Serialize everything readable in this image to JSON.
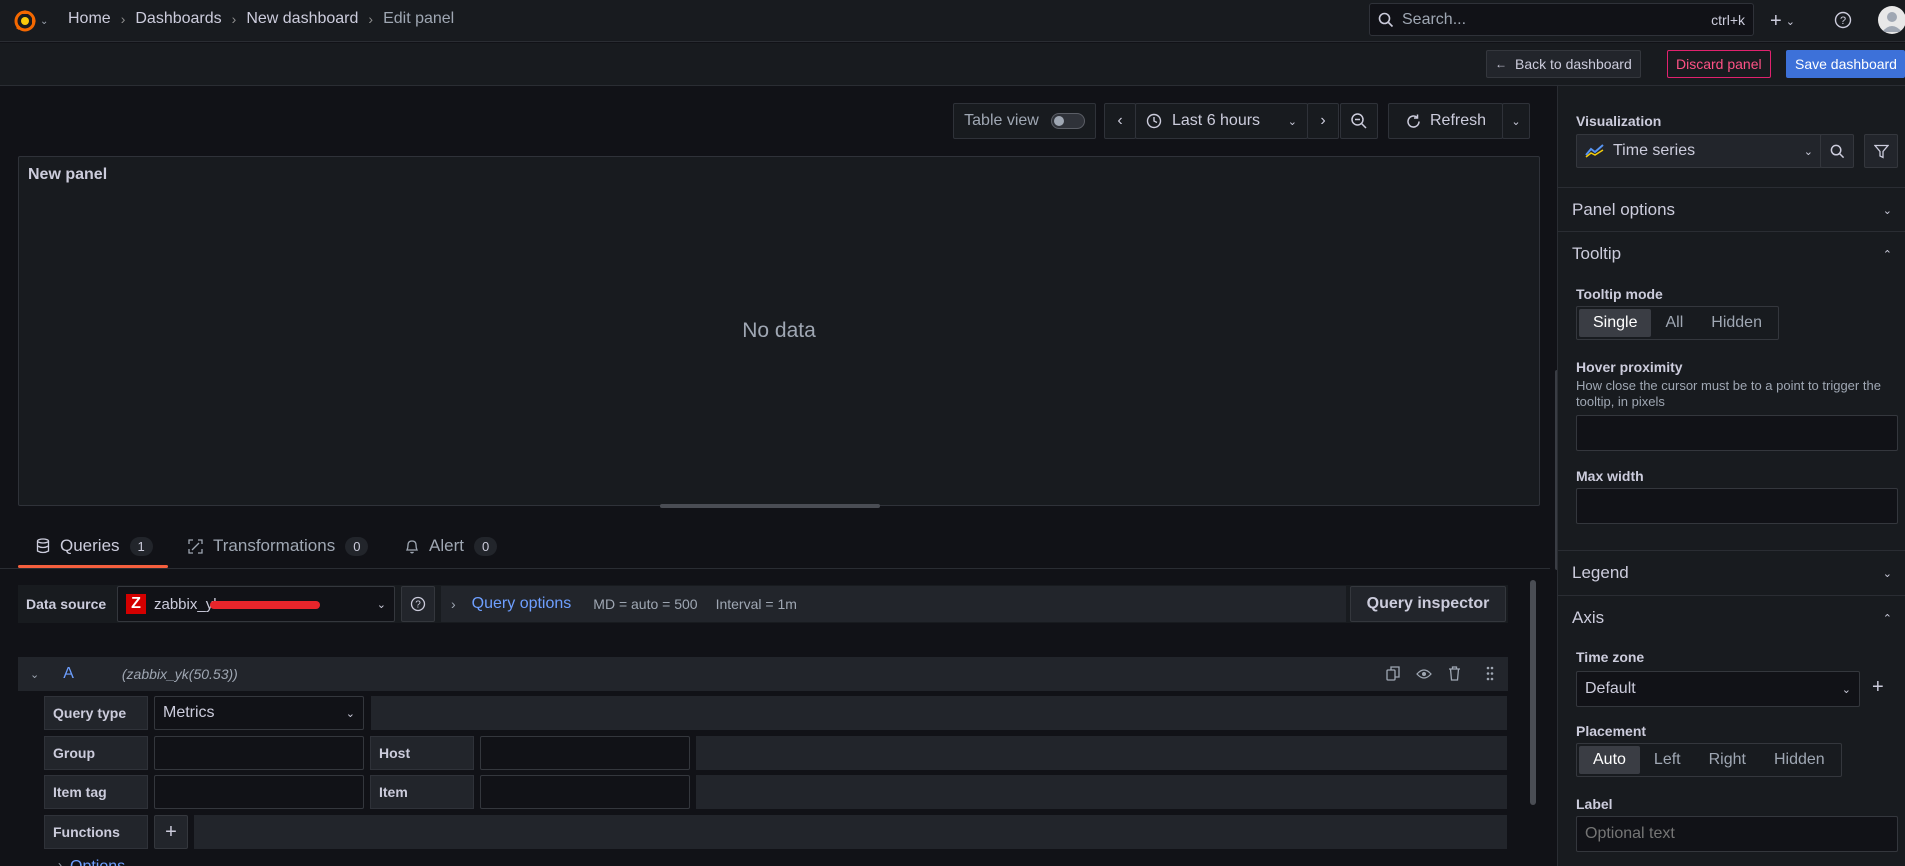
{
  "topbar": {
    "breadcrumbs": [
      "Home",
      "Dashboards",
      "New dashboard",
      "Edit panel"
    ],
    "search_placeholder": "Search...",
    "search_shortcut": "ctrl+k"
  },
  "actions": {
    "back": "Back to dashboard",
    "discard": "Discard panel",
    "save": "Save dashboard"
  },
  "toolbar": {
    "table_view": "Table view",
    "time_range": "Last 6 hours",
    "refresh": "Refresh"
  },
  "panel": {
    "title": "New panel",
    "empty": "No data"
  },
  "tabs": [
    {
      "label": "Queries",
      "count": "1"
    },
    {
      "label": "Transformations",
      "count": "0"
    },
    {
      "label": "Alert",
      "count": "0"
    }
  ],
  "query": {
    "datasource_label": "Data source",
    "datasource_value": "zabbix_yk",
    "query_options": "Query options",
    "md": "MD = auto = 500",
    "interval": "Interval = 1m",
    "inspector": "Query inspector",
    "ref_id": "A",
    "ref_desc": "(zabbix_yk(50.53))",
    "query_type_label": "Query type",
    "query_type_value": "Metrics",
    "group_label": "Group",
    "host_label": "Host",
    "item_tag_label": "Item tag",
    "item_label": "Item",
    "functions_label": "Functions",
    "options_label": "Options"
  },
  "sidebar": {
    "visualization_label": "Visualization",
    "visualization_value": "Time series",
    "panel_options": "Panel options",
    "tooltip": "Tooltip",
    "tooltip_mode_label": "Tooltip mode",
    "tooltip_modes": [
      "Single",
      "All",
      "Hidden"
    ],
    "tooltip_mode_selected": "Single",
    "hover_label": "Hover proximity",
    "hover_desc": "How close the cursor must be to a point to trigger the tooltip, in pixels",
    "max_width_label": "Max width",
    "legend": "Legend",
    "axis": "Axis",
    "timezone_label": "Time zone",
    "timezone_value": "Default",
    "placement_label": "Placement",
    "placements": [
      "Auto",
      "Left",
      "Right",
      "Hidden"
    ],
    "placement_selected": "Auto",
    "label_label": "Label",
    "label_placeholder": "Optional text"
  },
  "colors": {
    "accent": "#f55f3e",
    "primary": "#3d71d9",
    "danger": "#ff5286",
    "background": "#111217",
    "panel": "#181b1f"
  }
}
